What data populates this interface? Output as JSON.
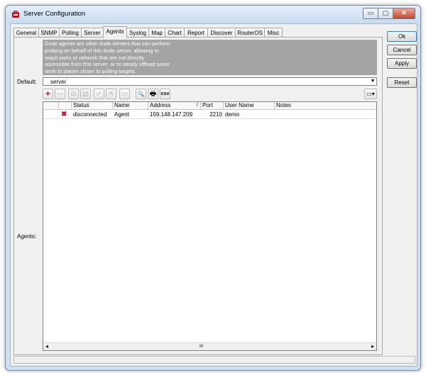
{
  "window": {
    "title": "Server Configuration"
  },
  "titlebar_buttons": {
    "minimize": "▭",
    "maximize": "▢",
    "close": "✕"
  },
  "tabs": [
    "General",
    "SNMP",
    "Polling",
    "Server",
    "Agents",
    "Syslog",
    "Map",
    "Chart",
    "Report",
    "Discover",
    "RouterOS",
    "Misc"
  ],
  "active_tab": "Agents",
  "description": [
    "Dude agents are other dude servers that can perform",
    "probing on behalf of this dude server, allowing to",
    "reach parts of network that are not directly",
    "accessible from this server, or to simply offload some",
    "work to places closer to polling targets"
  ],
  "default": {
    "label": "Default:",
    "value": "server"
  },
  "agents_label": "Agents:",
  "toolbar": {
    "add": "+",
    "remove": "—",
    "copy": "⧉",
    "paste": "▤",
    "enable": "✓",
    "disable": "✕",
    "comment": "▭",
    "find": "🔍",
    "print": "🖶",
    "csv": "csv",
    "columns": "▭▾"
  },
  "table": {
    "columns": [
      "",
      "",
      "Status",
      "Name",
      "Address",
      "Port",
      "User Name",
      "Notes"
    ],
    "sort_indicator": "/",
    "rows": [
      {
        "flag": "",
        "icon": "✖",
        "status": "disconnected",
        "name": "Agent",
        "address": "159.148.147.209",
        "port": "2210",
        "user": "demo",
        "notes": ""
      }
    ],
    "hscroll": {
      "left": "◂",
      "thumb": "III",
      "right": "▸"
    }
  },
  "buttons": {
    "ok": "Ok",
    "cancel": "Cancel",
    "apply": "Apply",
    "reset": "Reset"
  },
  "colors": {
    "description_bg": "#a4a4a4",
    "add_icon": "#c8102e",
    "error_icon": "#c8102e"
  }
}
